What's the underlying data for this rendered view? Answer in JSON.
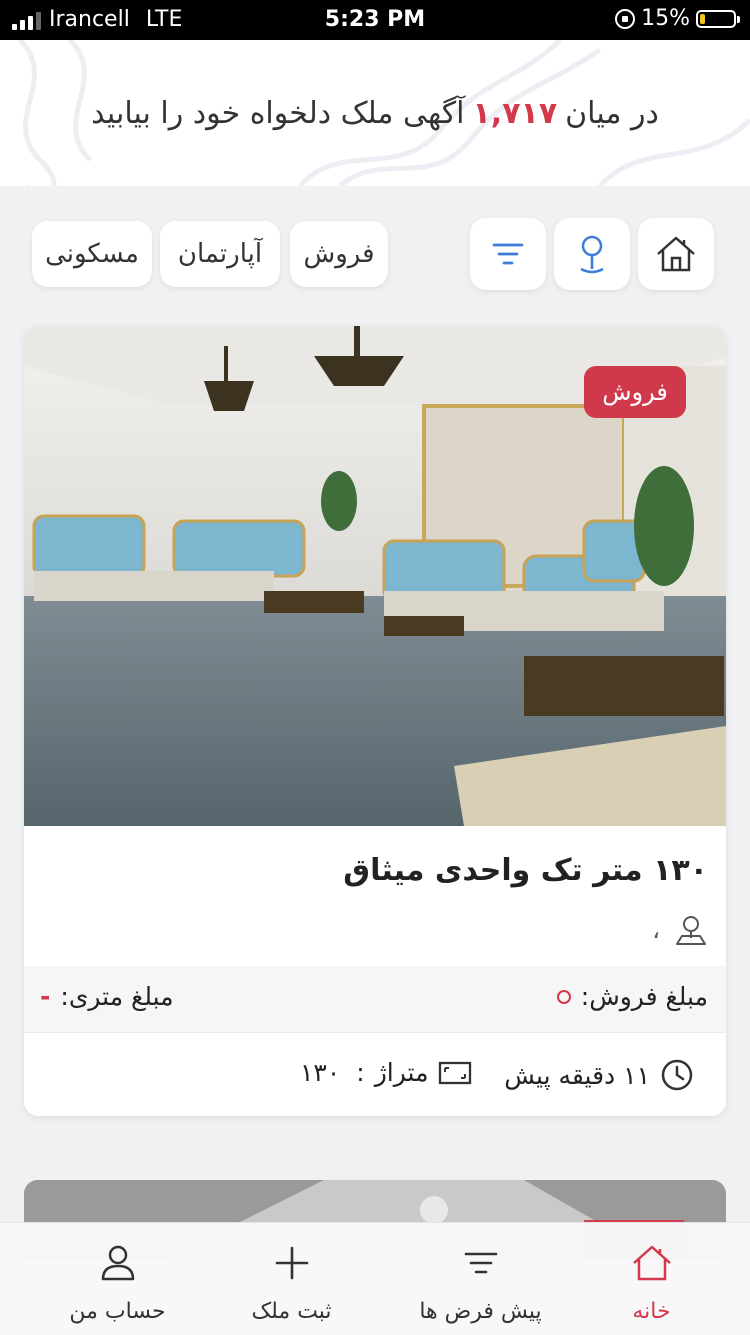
{
  "status_bar": {
    "carrier": "Irancell",
    "network": "LTE",
    "time": "5:23 PM",
    "battery": "15%",
    "battery_level": 0.15
  },
  "header": {
    "prefix": "در میان",
    "count": "۱,۷۱۷",
    "suffix": "آگهی ملک دلخواه خود را بیابید"
  },
  "filters": {
    "chips": [
      "فروش",
      "آپارتمان",
      "مسکونی"
    ],
    "icons": [
      "home-icon",
      "map-pin-icon",
      "filter-icon"
    ]
  },
  "listing": {
    "badge": "فروش",
    "title": "۱۳۰ متر تک واحدی میثاق",
    "location": "،",
    "price_label": "مبلغ فروش:",
    "price_per_meter_label": "مبلغ متری:",
    "price_per_meter_value": "-",
    "time_ago": "۱۱ دقیقه پیش",
    "area_label": "متراژ",
    "area_sep": ":",
    "area_value": "۱۳۰"
  },
  "tabbar": {
    "tabs": [
      {
        "label": "خانه",
        "icon": "home-icon",
        "active": true
      },
      {
        "label": "پیش فرض ها",
        "icon": "filter-icon",
        "active": false
      },
      {
        "label": "ثبت ملک",
        "icon": "plus-icon",
        "active": false
      },
      {
        "label": "حساب من",
        "icon": "user-icon",
        "active": false
      }
    ]
  },
  "colors": {
    "accent": "#d3394b",
    "pin": "#3b7dd8"
  }
}
